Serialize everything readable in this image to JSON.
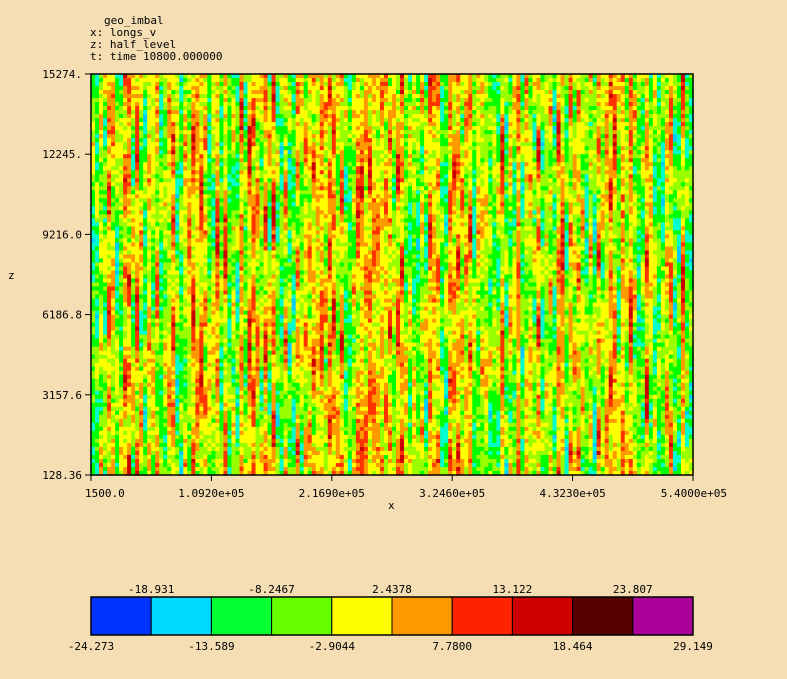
{
  "header": {
    "variable": "geo_imbal",
    "x_line": "x: longs_v",
    "z_line": "z: half_level",
    "t_line": "t: time 10800.000000"
  },
  "chart_data": {
    "type": "heatmap",
    "title": "geo_imbal",
    "xlabel": "x",
    "ylabel": "z",
    "x_ticks": [
      "1500.0",
      "1.0920e+05",
      "2.1690e+05",
      "3.2460e+05",
      "4.3230e+05",
      "5.4000e+05"
    ],
    "x_tick_values": [
      1500.0,
      109200,
      216900,
      324600,
      432300,
      540000
    ],
    "y_ticks": [
      "128.36",
      "3157.6",
      "6186.8",
      "9216.0",
      "12245.",
      "15274."
    ],
    "y_tick_values": [
      128.36,
      3157.6,
      6186.8,
      9216.0,
      12245,
      15274
    ],
    "xlim": [
      1500.0,
      540000
    ],
    "ylim": [
      128.36,
      15274
    ],
    "value_range": [
      -24.273,
      29.149
    ],
    "colorbar": {
      "bounds": [
        -24.273,
        -18.931,
        -13.589,
        -8.2467,
        -2.9044,
        2.4378,
        7.78,
        13.122,
        18.464,
        23.807,
        29.149
      ],
      "upper_labels": [
        "-18.931",
        "-8.2467",
        "2.4378",
        "13.122",
        "23.807"
      ],
      "lower_labels": [
        "-24.273",
        "-13.589",
        "-2.9044",
        "7.7800",
        "18.464",
        "29.149"
      ],
      "colors": [
        "#0033ff",
        "#00d9ff",
        "#00ff33",
        "#66ff00",
        "#ffff00",
        "#ff9900",
        "#ff2200",
        "#cc0000",
        "#550000",
        "#aa0099"
      ]
    },
    "field_colors": {
      "blue": "#00ccff",
      "cyan": "#00ffcc",
      "green": "#00ff00",
      "lime": "#99ff00",
      "yellow": "#ffff00",
      "orange": "#ff9900",
      "red": "#ff3300",
      "darkred": "#cc0000"
    },
    "colors": {
      "background": "#f5deb3",
      "frame": "#000000"
    }
  }
}
